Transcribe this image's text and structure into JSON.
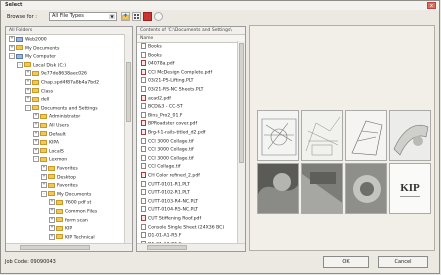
{
  "window": {
    "title": "Select",
    "close": "x"
  },
  "toolbar": {
    "browse_label": "Browse for :",
    "file_type": "All File Types"
  },
  "left_pane": {
    "header": "All Folders",
    "items": [
      {
        "label": "Web2000",
        "kind": "pc",
        "expander": "+",
        "depth": 0
      },
      {
        "label": "My Documents",
        "kind": "folder",
        "expander": "+",
        "depth": 0
      },
      {
        "label": "My Computer",
        "kind": "pc",
        "expander": "-",
        "depth": 0
      },
      {
        "label": "Local Disk (C:)",
        "kind": "folder",
        "expander": "-",
        "depth": 1
      },
      {
        "label": "9e77de8638aec026",
        "kind": "folder",
        "expander": "+",
        "depth": 2
      },
      {
        "label": "Chap.spd4f87a8b4a7bd2",
        "kind": "folder",
        "expander": "+",
        "depth": 2
      },
      {
        "label": "Class",
        "kind": "folder",
        "expander": "+",
        "depth": 2
      },
      {
        "label": "dell",
        "kind": "folder",
        "expander": "+",
        "depth": 2
      },
      {
        "label": "Documents and Settings",
        "kind": "folder",
        "expander": "-",
        "depth": 2
      },
      {
        "label": "Administrator",
        "kind": "folder",
        "expander": "+",
        "depth": 3
      },
      {
        "label": "All Users",
        "kind": "folder",
        "expander": "+",
        "depth": 3
      },
      {
        "label": "Default",
        "kind": "folder",
        "expander": "+",
        "depth": 3
      },
      {
        "label": "KIPA",
        "kind": "folder",
        "expander": "+",
        "depth": 3
      },
      {
        "label": "LocalS",
        "kind": "folder",
        "expander": "+",
        "depth": 3
      },
      {
        "label": "Lexmon",
        "kind": "folder",
        "expander": "-",
        "depth": 3
      },
      {
        "label": "Favorites",
        "kind": "folder",
        "expander": "+",
        "depth": 4
      },
      {
        "label": "Desktop",
        "kind": "folder",
        "expander": "+",
        "depth": 4
      },
      {
        "label": "Favorites",
        "kind": "folder",
        "expander": "+",
        "depth": 4
      },
      {
        "label": "My Documents",
        "kind": "folder",
        "expander": "-",
        "depth": 4
      },
      {
        "label": "7600 pdf st",
        "kind": "folder",
        "expander": "+",
        "depth": 5
      },
      {
        "label": "Common Files",
        "kind": "folder",
        "expander": "+",
        "depth": 5
      },
      {
        "label": "form scan",
        "kind": "folder",
        "expander": "+",
        "depth": 5
      },
      {
        "label": "KIP",
        "kind": "folder",
        "expander": "+",
        "depth": 5
      },
      {
        "label": "KIP Technical",
        "kind": "folder",
        "expander": "+",
        "depth": 5
      }
    ]
  },
  "mid_pane": {
    "header": "Contents of 'C:\\Documents and Settings\\",
    "column": "Name",
    "files": [
      {
        "name": "Books",
        "type": "doc"
      },
      {
        "name": "Books",
        "type": "doc"
      },
      {
        "name": "04078a.pdf",
        "type": "pdf"
      },
      {
        "name": "CCI McDesign Complete.pdf",
        "type": "pdf"
      },
      {
        "name": "03/21-PS-Lifting.PLT",
        "type": "doc"
      },
      {
        "name": "03/21-RS-NC Sheets.PLT",
        "type": "doc"
      },
      {
        "name": "acad2.pdf",
        "type": "pdf"
      },
      {
        "name": "BCD&3 - CC-ST",
        "type": "doc"
      },
      {
        "name": "Bins_Pro2_01.F",
        "type": "doc"
      },
      {
        "name": "BPRoadster cover.pdf",
        "type": "pdf"
      },
      {
        "name": "Brg-f-1-rails-titled_d2.pdf",
        "type": "pdf"
      },
      {
        "name": "CCI 3000 Collage.tif",
        "type": "doc"
      },
      {
        "name": "CCI 3000 Collage.tif",
        "type": "doc"
      },
      {
        "name": "CCI 3000 Collage.tif",
        "type": "doc"
      },
      {
        "name": "CCI Collage.tif",
        "type": "doc"
      },
      {
        "name": "CH Color refined_2.pdf",
        "type": "pdf"
      },
      {
        "name": "CUTT-0101-R1.PLT",
        "type": "doc"
      },
      {
        "name": "CUTT-0102-R1.PLT",
        "type": "doc"
      },
      {
        "name": "CUTT-0103-R4-NC.PLT",
        "type": "doc"
      },
      {
        "name": "CUTT-0104-R5-NC.PLT",
        "type": "doc"
      },
      {
        "name": "CUT Stiffening Roof.pdf",
        "type": "pdf"
      },
      {
        "name": "Console Single Sheet (24X36 BC)",
        "type": "doc"
      },
      {
        "name": "D1-01-A1-R5.F",
        "type": "doc"
      },
      {
        "name": "D1-01-A2-R5.F",
        "type": "doc"
      }
    ]
  },
  "preview": {
    "logo_text": "KIP"
  },
  "status": {
    "label": "Job Code: 09090043"
  },
  "buttons": {
    "ok": "OK",
    "cancel": "Cancel"
  },
  "colors": {
    "folder": "#f1c75a",
    "accent": "#3d6aa8",
    "window_bg": "#ece9e2"
  }
}
